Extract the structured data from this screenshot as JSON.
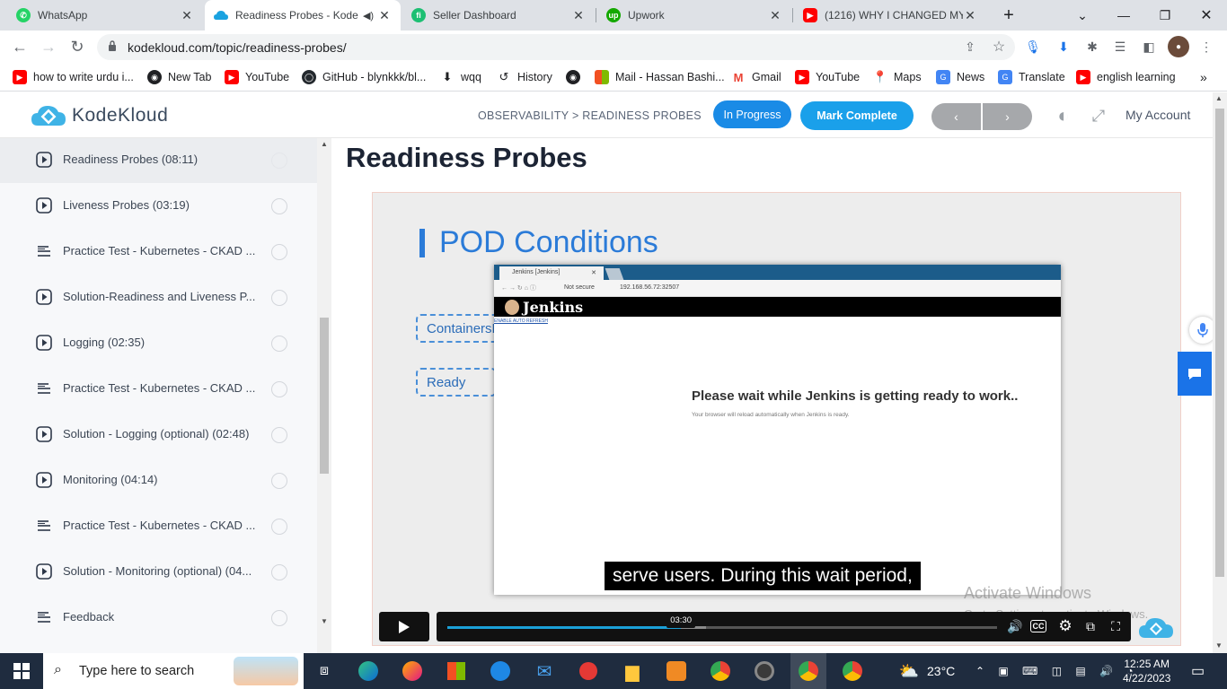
{
  "browser": {
    "tabs": [
      {
        "title": "WhatsApp",
        "icon": "whatsapp-icon",
        "color": "#25d366",
        "active": false
      },
      {
        "title": "Readiness Probes - Kode",
        "icon": "kodekloud-icon",
        "color": "#1aa2e0",
        "active": true
      },
      {
        "title": "Seller Dashboard",
        "icon": "fiverr-icon",
        "color": "#1dbf73",
        "active": false
      },
      {
        "title": "Upwork",
        "icon": "upwork-icon",
        "color": "#14a800",
        "active": false
      },
      {
        "title": "(1216) WHY I CHANGED MY",
        "icon": "youtube-icon",
        "color": "#ff0000",
        "active": false
      }
    ],
    "new_tab_label": "+",
    "address": "kodekloud.com/topic/readiness-probes/",
    "bookmarks": [
      {
        "label": "how to write urdu i...",
        "icon": "youtube-icon",
        "color": "#ff0000"
      },
      {
        "label": "New Tab",
        "icon": "globe-icon",
        "color": "#202124"
      },
      {
        "label": "YouTube",
        "icon": "youtube-icon",
        "color": "#ff0000"
      },
      {
        "label": "GitHub - blynkkk/bl...",
        "icon": "github-icon",
        "color": "#24292e"
      },
      {
        "label": "wqq",
        "icon": "download-icon",
        "color": "#202124"
      },
      {
        "label": "History",
        "icon": "history-icon",
        "color": "#202124"
      },
      {
        "label": "",
        "icon": "globe-icon",
        "color": "#202124"
      },
      {
        "label": "Mail - Hassan Bashi...",
        "icon": "microsoft-icon",
        "color": "#f25022"
      },
      {
        "label": "Gmail",
        "icon": "gmail-icon",
        "color": "#ea4335"
      },
      {
        "label": "YouTube",
        "icon": "youtube-icon",
        "color": "#ff0000"
      },
      {
        "label": "Maps",
        "icon": "maps-icon",
        "color": "#34a853"
      },
      {
        "label": "News",
        "icon": "news-icon",
        "color": "#4285f4"
      },
      {
        "label": "Translate",
        "icon": "translate-icon",
        "color": "#4285f4"
      },
      {
        "label": "english learning",
        "icon": "youtube-icon",
        "color": "#ff0000"
      }
    ]
  },
  "header": {
    "logo_text": "KodeKloud",
    "breadcrumb": "OBSERVABILITY > READINESS PROBES",
    "status_label": "In Progress",
    "mark_complete_label": "Mark Complete",
    "prev_label": "‹",
    "next_label": "›",
    "account_label": "My Account",
    "accent": "#1a8be6"
  },
  "sidebar": {
    "items": [
      {
        "label": "Readiness Probes (08:11)",
        "type": "video",
        "active": true
      },
      {
        "label": "Liveness Probes (03:19)",
        "type": "video",
        "active": false
      },
      {
        "label": "Practice Test - Kubernetes - CKAD ...",
        "type": "lab",
        "active": false
      },
      {
        "label": "Solution-Readiness and Liveness P...",
        "type": "video",
        "active": false
      },
      {
        "label": "Logging (02:35)",
        "type": "video",
        "active": false
      },
      {
        "label": "Practice Test - Kubernetes - CKAD ...",
        "type": "lab",
        "active": false
      },
      {
        "label": "Solution - Logging (optional) (02:48)",
        "type": "video",
        "active": false
      },
      {
        "label": "Monitoring (04:14)",
        "type": "video",
        "active": false
      },
      {
        "label": "Practice Test - Kubernetes - CKAD ...",
        "type": "lab",
        "active": false
      },
      {
        "label": "Solution - Monitoring (optional) (04...",
        "type": "video",
        "active": false
      },
      {
        "label": "Feedback",
        "type": "lab",
        "active": false
      }
    ]
  },
  "main": {
    "title": "Readiness Probes",
    "video": {
      "slide_title": "POD Conditions",
      "conditions": [
        "ContainersR",
        "Ready"
      ],
      "jenkins": {
        "tab_title": "Jenkins [Jenkins]",
        "not_secure": "Not secure",
        "url": "192.168.56.72:32507",
        "brand": "Jenkins",
        "refresh_link": "ENABLE AUTO REFRESH",
        "message": "Please wait while Jenkins is getting ready to work..",
        "submessage": "Your browser will reload automatically when Jenkins is ready."
      },
      "caption": "serve users. During this wait period,",
      "current_time": "03:30",
      "progress": 0.425,
      "buffered": 0.47,
      "watermark_title": "Activate Windows",
      "watermark_sub": "Go to Settings to activate Windows."
    }
  },
  "taskbar": {
    "search_placeholder": "Type here to search",
    "weather": "23°C",
    "time": "12:25 AM",
    "date": "4/22/2023"
  }
}
